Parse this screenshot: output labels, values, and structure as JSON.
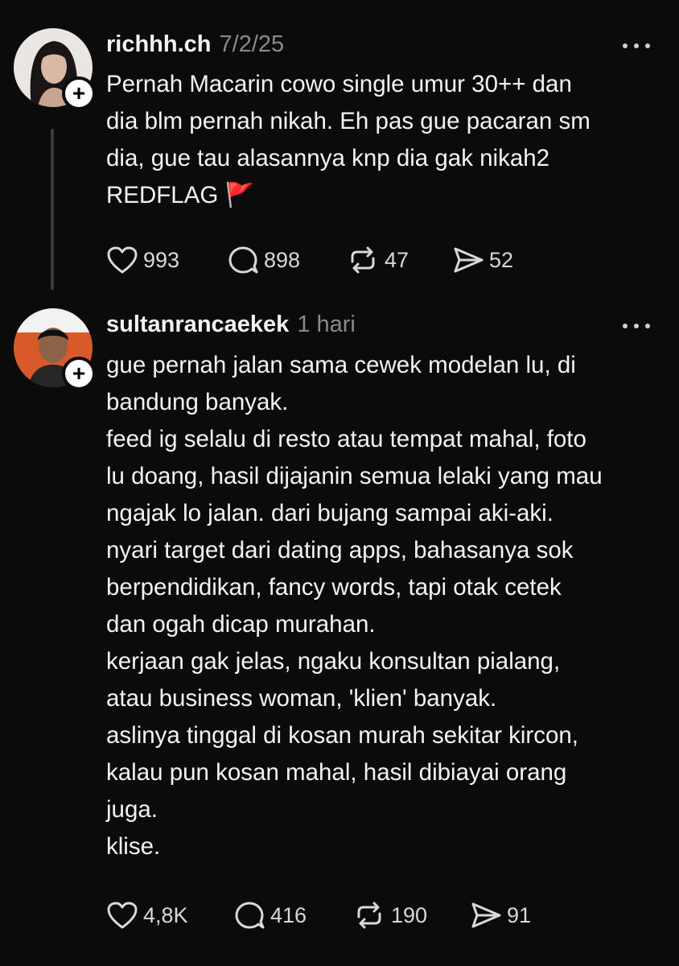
{
  "posts": [
    {
      "username": "richhh.ch",
      "time": "7/2/25",
      "lines": [
        "Pernah Macarin cowo single umur 30++ dan",
        "dia blm pernah nikah. Eh pas gue pacaran sm",
        "dia, gue tau alasannya knp dia gak nikah2",
        "REDFLAG 🚩"
      ],
      "likes": "993",
      "comments": "898",
      "reposts": "47",
      "shares": "52"
    },
    {
      "username": "sultanrancaekek",
      "time": "1 hari",
      "lines": [
        "gue pernah jalan sama cewek modelan lu, di",
        "bandung banyak.",
        "feed ig selalu di resto atau tempat mahal, foto",
        "lu doang, hasil dijajanin semua lelaki yang mau",
        "ngajak lo jalan. dari bujang sampai aki-aki.",
        "nyari target dari dating apps, bahasanya sok",
        "berpendidikan, fancy words, tapi otak cetek",
        "dan ogah dicap murahan.",
        "kerjaan gak jelas, ngaku konsultan pialang,",
        "atau business woman, 'klien' banyak.",
        "aslinya tinggal di kosan murah sekitar kircon,",
        "kalau pun kosan mahal, hasil dibiayai orang",
        "juga.",
        "klise."
      ],
      "likes": "4,8K",
      "comments": "416",
      "reposts": "190",
      "shares": "91"
    }
  ],
  "icons": {
    "follow": "+",
    "like": "heart-icon",
    "comment": "comment-icon",
    "repost": "repost-icon",
    "share": "send-icon",
    "more": "more-icon"
  },
  "colors": {
    "background": "#0b0b0b",
    "text": "#f3f3f3",
    "muted": "#8a8a8a",
    "redflag": "#e0302b"
  }
}
